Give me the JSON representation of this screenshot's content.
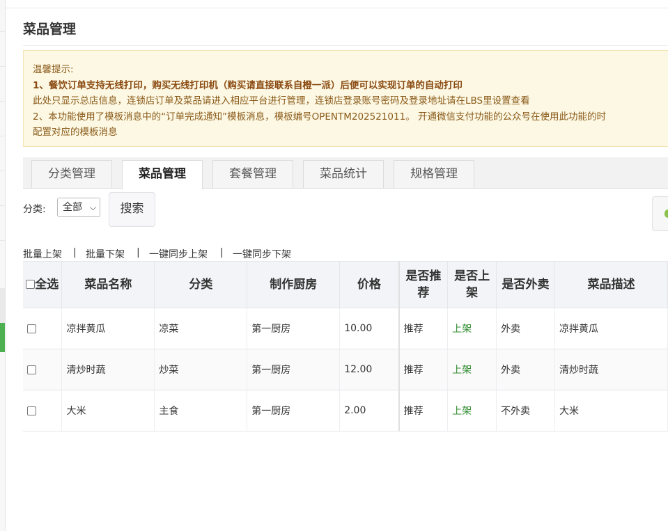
{
  "page": {
    "title": "菜品管理"
  },
  "notice": {
    "line1": "温馨提示:",
    "line2": "1、餐饮订单支持无线打印，购买无线打印机（购买请直接联系自橙一派）后便可以实现订单的自动打印",
    "line3": "此处只显示总店信息，连锁店订单及菜品请进入相应平台进行管理，连锁店登录账号密码及登录地址请在LBS里设置查看",
    "line4": "2、本功能使用了模板消息中的“订单完成通知”模板消息，模板编号OPENTM202521011。 开通微信支付功能的公众号在使用此功能的时",
    "line5": "配置对应的模板消息"
  },
  "tabs": [
    {
      "label": "分类管理"
    },
    {
      "label": "菜品管理",
      "active": true
    },
    {
      "label": "套餐管理"
    },
    {
      "label": "菜品统计"
    },
    {
      "label": "规格管理"
    }
  ],
  "filter": {
    "label": "分类:",
    "selected": "全部",
    "search_label": "搜索"
  },
  "bulk": {
    "on_shelf": "批量上架",
    "off_shelf": "批量下架",
    "sync_on": "一键同步上架",
    "sync_off": "一键同步下架",
    "separator": "|"
  },
  "table": {
    "headers": {
      "select_all": "全选",
      "name": "菜品名称",
      "category": "分类",
      "kitchen": "制作厨房",
      "price": "价格",
      "recommend": "是否推荐",
      "on_shelf": "是否上架",
      "takeout": "是否外卖",
      "desc": "菜品描述"
    },
    "rows": [
      {
        "name": "凉拌黄瓜",
        "category": "凉菜",
        "kitchen": "第一厨房",
        "price": "10.00",
        "recommend": "推荐",
        "on_shelf": "上架",
        "takeout": "外卖",
        "desc": "凉拌黄瓜"
      },
      {
        "name": "清炒时蔬",
        "category": "炒菜",
        "kitchen": "第一厨房",
        "price": "12.00",
        "recommend": "推荐",
        "on_shelf": "上架",
        "takeout": "外卖",
        "desc": "清炒时蔬"
      },
      {
        "name": "大米",
        "category": "主食",
        "kitchen": "第一厨房",
        "price": "2.00",
        "recommend": "推荐",
        "on_shelf": "上架",
        "takeout": "不外卖",
        "desc": "大米"
      }
    ]
  },
  "colors": {
    "status_green": "#2e8b2e",
    "notice_bg": "#fcf8e3",
    "notice_text": "#8a5a1a",
    "accent_green": "#4caf50"
  }
}
